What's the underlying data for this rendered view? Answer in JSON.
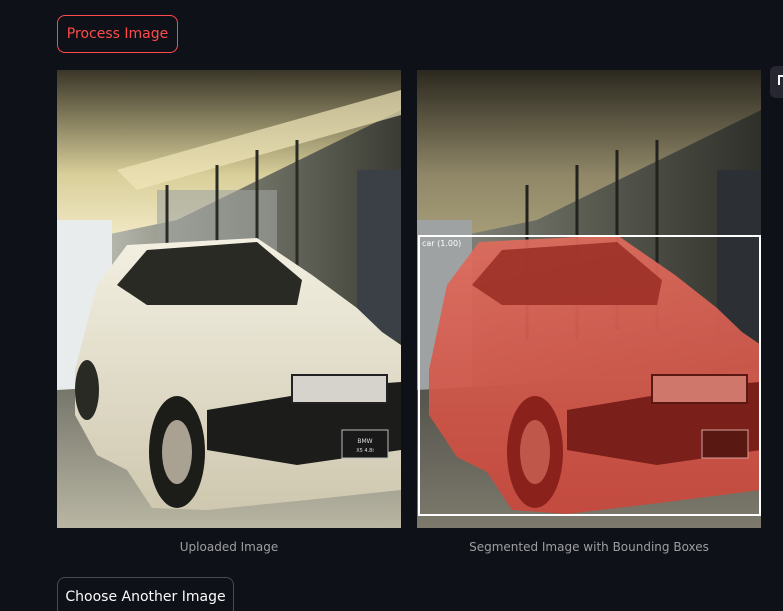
{
  "buttons": {
    "process_label": "Process Image",
    "choose_label": "Choose Another Image"
  },
  "images": {
    "uploaded_caption": "Uploaded Image",
    "segmented_caption": "Segmented Image with Bounding Boxes",
    "detection_label": "car (1.00)",
    "plate_line1": "BMW",
    "plate_line2": "X5 4.8i"
  },
  "colors": {
    "background": "#0e1117",
    "accent": "#ff4b4b",
    "mask": "#e0463a",
    "bbox": "#ffffff"
  }
}
